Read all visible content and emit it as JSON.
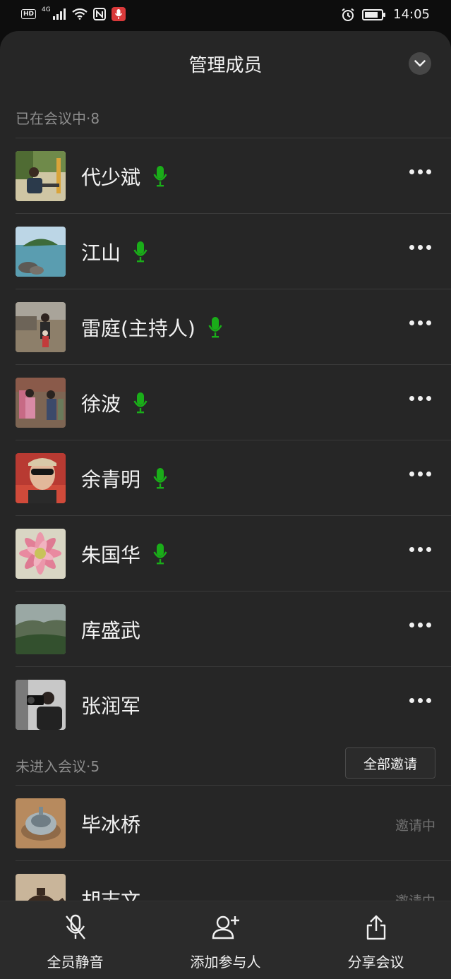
{
  "status_bar": {
    "hd": "HD",
    "network": "4G",
    "time": "14:05"
  },
  "sheet": {
    "title": "管理成员"
  },
  "in_meeting": {
    "label": "已在会议中·8",
    "members": [
      {
        "name": "代少斌",
        "mic_on": true
      },
      {
        "name": "江山",
        "mic_on": true
      },
      {
        "name": "雷庭(主持人)",
        "mic_on": true
      },
      {
        "name": "徐波",
        "mic_on": true
      },
      {
        "name": "余青明",
        "mic_on": true
      },
      {
        "name": "朱国华",
        "mic_on": true
      },
      {
        "name": "库盛武",
        "mic_on": false
      },
      {
        "name": "张润军",
        "mic_on": false
      }
    ]
  },
  "not_joined": {
    "label": "未进入会议·5",
    "invite_all_label": "全部邀请",
    "members": [
      {
        "name": "毕冰桥",
        "status": "邀请中"
      },
      {
        "name": "胡志文",
        "status": "邀请中"
      }
    ]
  },
  "bottom_bar": {
    "mute_all": "全员静音",
    "add_participant": "添加参与人",
    "share_meeting": "分享会议"
  },
  "colors": {
    "mic_green": "#1aad19",
    "sheet_bg": "#262626",
    "accent_red": "#d9393a"
  },
  "icons": [
    "mic-icon",
    "more-icon",
    "chevron-down-icon",
    "mic-off-icon",
    "add-person-icon",
    "share-icon",
    "alarm-icon",
    "battery-icon",
    "wifi-icon",
    "signal-icon",
    "nfc-icon"
  ]
}
